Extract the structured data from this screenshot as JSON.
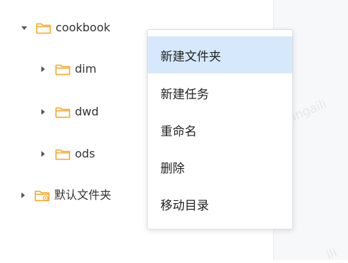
{
  "tree": {
    "root": {
      "label": "cookbook",
      "expanded": true
    },
    "children": [
      {
        "label": "dim",
        "expanded": false
      },
      {
        "label": "dwd",
        "expanded": false
      },
      {
        "label": "ods",
        "expanded": false
      }
    ],
    "default_folder": {
      "label": "默认文件夹",
      "expanded": false
    }
  },
  "context_menu": {
    "items": [
      {
        "label": "新建文件夹",
        "active": true
      },
      {
        "label": "新建任务",
        "active": false
      },
      {
        "label": "重命名",
        "active": false
      },
      {
        "label": "删除",
        "active": false
      },
      {
        "label": "移动目录",
        "active": false
      }
    ]
  },
  "watermark": {
    "text_1": "wb.shangaili",
    "text_2": "ili"
  },
  "colors": {
    "folder": "#f5a623",
    "menu_highlight": "#d6e8fb",
    "right_pane": "#f7f8fa"
  }
}
